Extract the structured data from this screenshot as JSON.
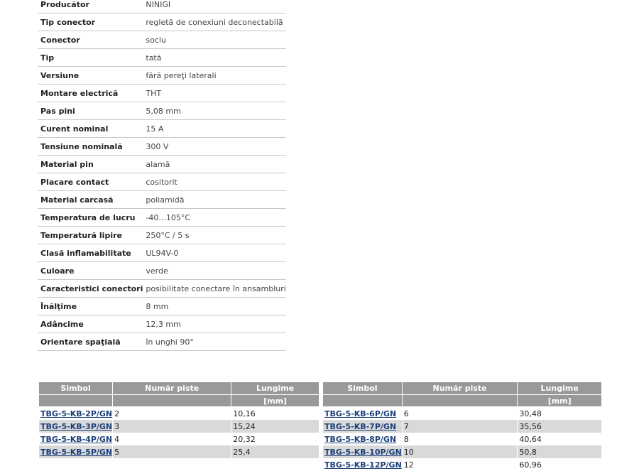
{
  "specs": [
    {
      "label": "Producător",
      "value": "NINIGI"
    },
    {
      "label": "Tip conector",
      "value": "regletă de conexiuni deconectabilă"
    },
    {
      "label": "Conector",
      "value": "soclu"
    },
    {
      "label": "Tip",
      "value": "tată"
    },
    {
      "label": "Versiune",
      "value": "fără pereţi laterali"
    },
    {
      "label": "Montare electrică",
      "value": "THT"
    },
    {
      "label": "Pas pini",
      "value": "5,08 mm"
    },
    {
      "label": "Curent nominal",
      "value": "15 A"
    },
    {
      "label": "Tensiune nominală",
      "value": "300 V"
    },
    {
      "label": "Material pin",
      "value": "alamă"
    },
    {
      "label": "Placare contact",
      "value": "cositorit"
    },
    {
      "label": "Material carcasă",
      "value": "poliamidă"
    },
    {
      "label": "Temperatura de lucru",
      "value": "-40...105°C"
    },
    {
      "label": "Temperatură lipire",
      "value": "250°C / 5 s"
    },
    {
      "label": "Clasă inflamabilitate",
      "value": "UL94V-0"
    },
    {
      "label": "Culoare",
      "value": "verde"
    },
    {
      "label": "Caracteristici conectori",
      "value": "posibilitate conectare în ansambluri"
    },
    {
      "label": "Înălţime",
      "value": "8 mm"
    },
    {
      "label": "Adâncime",
      "value": "12,3 mm"
    },
    {
      "label": "Orientare spaţială",
      "value": "în unghi 90°"
    }
  ],
  "product_tables": {
    "headers": {
      "symbol": "Simbol",
      "tracks": "Număr piste",
      "length": "Lungime",
      "length_unit": "[mm]"
    },
    "left": [
      {
        "symbol": "TBG-5-KB-2P/GN",
        "tracks": "2",
        "length": "10,16"
      },
      {
        "symbol": "TBG-5-KB-3P/GN",
        "tracks": "3",
        "length": "15,24"
      },
      {
        "symbol": "TBG-5-KB-4P/GN",
        "tracks": "4",
        "length": "20,32"
      },
      {
        "symbol": "TBG-5-KB-5P/GN",
        "tracks": "5",
        "length": "25,4"
      }
    ],
    "right": [
      {
        "symbol": "TBG-5-KB-6P/GN",
        "tracks": "6",
        "length": "30,48"
      },
      {
        "symbol": "TBG-5-KB-7P/GN",
        "tracks": "7",
        "length": "35,56"
      },
      {
        "symbol": "TBG-5-KB-8P/GN",
        "tracks": "8",
        "length": "40,64"
      },
      {
        "symbol": "TBG-5-KB-10P/GN",
        "tracks": "10",
        "length": "50,8"
      },
      {
        "symbol": "TBG-5-KB-12P/GN",
        "tracks": "12",
        "length": "60,96"
      }
    ]
  }
}
